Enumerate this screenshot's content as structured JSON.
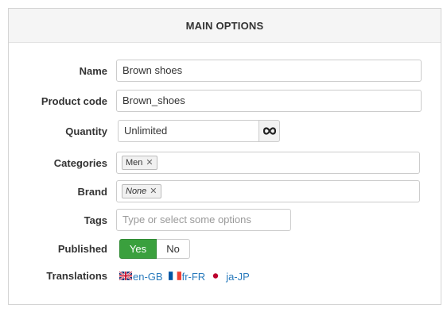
{
  "panel": {
    "title": "MAIN OPTIONS"
  },
  "fields": {
    "name": {
      "label": "Name",
      "value": "Brown shoes"
    },
    "product_code": {
      "label": "Product code",
      "value": "Brown_shoes"
    },
    "quantity": {
      "label": "Quantity",
      "value": "Unlimited",
      "icon": "infinity-icon"
    },
    "categories": {
      "label": "Categories",
      "tags": [
        "Men"
      ]
    },
    "brand": {
      "label": "Brand",
      "tags": [
        "None"
      ]
    },
    "tags": {
      "label": "Tags",
      "placeholder": "Type or select some options"
    },
    "published": {
      "label": "Published",
      "options": [
        "Yes",
        "No"
      ],
      "selected": "Yes"
    },
    "translations": {
      "label": "Translations",
      "items": [
        {
          "code": "en-GB",
          "icon": "uk-flag-icon"
        },
        {
          "code": "fr-FR",
          "icon": "france-flag-icon"
        },
        {
          "code": "ja-JP",
          "icon": "japan-flag-icon"
        }
      ]
    }
  },
  "colors": {
    "accent_green": "#3aa03d",
    "link_blue": "#2a7bbd"
  }
}
